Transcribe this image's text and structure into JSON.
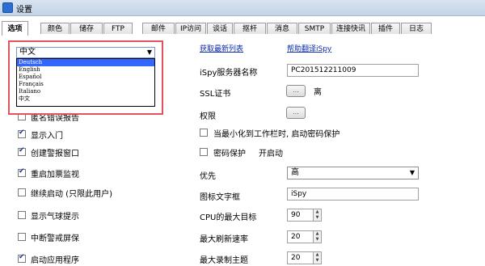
{
  "window": {
    "title": "设置"
  },
  "tabs": [
    {
      "label": "选项",
      "active": true
    },
    {
      "label": "颜色"
    },
    {
      "label": "储存"
    },
    {
      "label": "FTP"
    },
    {
      "label": "邮件"
    },
    {
      "label": "IP访问"
    },
    {
      "label": "谈话"
    },
    {
      "label": "抠杆"
    },
    {
      "label": "消息"
    },
    {
      "label": "SMTP"
    },
    {
      "label": "连接快讯"
    },
    {
      "label": "插件"
    },
    {
      "label": "日志"
    }
  ],
  "language": {
    "selected": "中文",
    "options": [
      "Deutsch",
      "English",
      "Español",
      "Français",
      "Italiano",
      "中文"
    ],
    "highlighted_index": 0
  },
  "links": {
    "latest_list": "获取最新列表",
    "help_translate": "帮助翻译iSpy"
  },
  "left_options": [
    {
      "label": "匿名错误报告",
      "checked": false
    },
    {
      "label": "显示入门",
      "checked": true
    },
    {
      "label": "创建警报窗口",
      "checked": true
    },
    {
      "label": "重启加票监视",
      "checked": true
    },
    {
      "label": "继续启动 (只限此用户)",
      "checked": false
    },
    {
      "label": "显示气球提示",
      "checked": false
    },
    {
      "label": "中断警戒屏保",
      "checked": false
    },
    {
      "label": "启动应用程序",
      "checked": true
    }
  ],
  "right": {
    "server_name_label": "iSpy服务器名称",
    "server_name_value": "PC201512211009",
    "ssl_label": "SSL证书",
    "ssl_button": "...",
    "ssl_status": "离",
    "permission_label": "权限",
    "permission_button": "...",
    "minimize_label": "当最小化到工作栏时, 启动密码保护",
    "minimize_checked": false,
    "password_label": "密码保护",
    "password_checked": false,
    "startup_label": "开启动",
    "priority_label": "优先",
    "priority_value": "高",
    "tray_text_label": "图标文字框",
    "tray_text_value": "iSpy",
    "cpu_label": "CPU的最大目标",
    "cpu_value": "90",
    "refresh_label": "最大刷新速率",
    "refresh_value": "20",
    "record_label": "最大录制主题",
    "record_value": "20"
  }
}
